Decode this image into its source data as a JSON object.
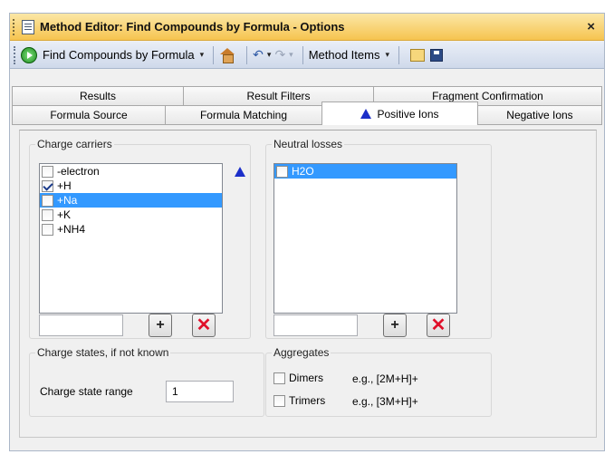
{
  "window": {
    "title": "Method Editor: Find Compounds by Formula - Options",
    "close_label": "×"
  },
  "toolbar": {
    "method_dropdown": "Find Compounds by Formula",
    "method_items": "Method Items",
    "dropdown_arrow": "▾",
    "undo_glyph": "↶",
    "redo_glyph": "↷"
  },
  "tabs": {
    "row1": [
      "Results",
      "Result Filters",
      "Fragment Confirmation"
    ],
    "row2": [
      "Formula Source",
      "Formula Matching",
      "Positive Ions",
      "Negative Ions"
    ],
    "active": "Positive Ions"
  },
  "charge_carriers": {
    "legend": "Charge carriers",
    "items": [
      {
        "label": "-electron",
        "checked": false,
        "selected": false
      },
      {
        "label": "+H",
        "checked": true,
        "selected": false
      },
      {
        "label": "+Na",
        "checked": false,
        "selected": true
      },
      {
        "label": "+K",
        "checked": false,
        "selected": false
      },
      {
        "label": "+NH4",
        "checked": false,
        "selected": false
      }
    ],
    "input_value": ""
  },
  "neutral_losses": {
    "legend": "Neutral losses",
    "items": [
      {
        "label": "H2O",
        "checked": false,
        "selected": true
      }
    ],
    "input_value": ""
  },
  "charge_states": {
    "legend": "Charge states, if not known",
    "range_label": "Charge state range",
    "range_value": "1"
  },
  "aggregates": {
    "legend": "Aggregates",
    "dimers_label": "Dimers",
    "dimers_example": "e.g., [2M+H]+",
    "trimers_label": "Trimers",
    "trimers_example": "e.g., [3M+H]+"
  },
  "buttons": {
    "add_glyph": "+",
    "delete_glyph": "✕"
  },
  "colors": {
    "title_gradient_top": "#fbe7a6",
    "title_gradient_bottom": "#f6c44f",
    "selection": "#3399ff",
    "delete_red": "#e0102a",
    "ion_icon_blue": "#1c2fc9"
  }
}
